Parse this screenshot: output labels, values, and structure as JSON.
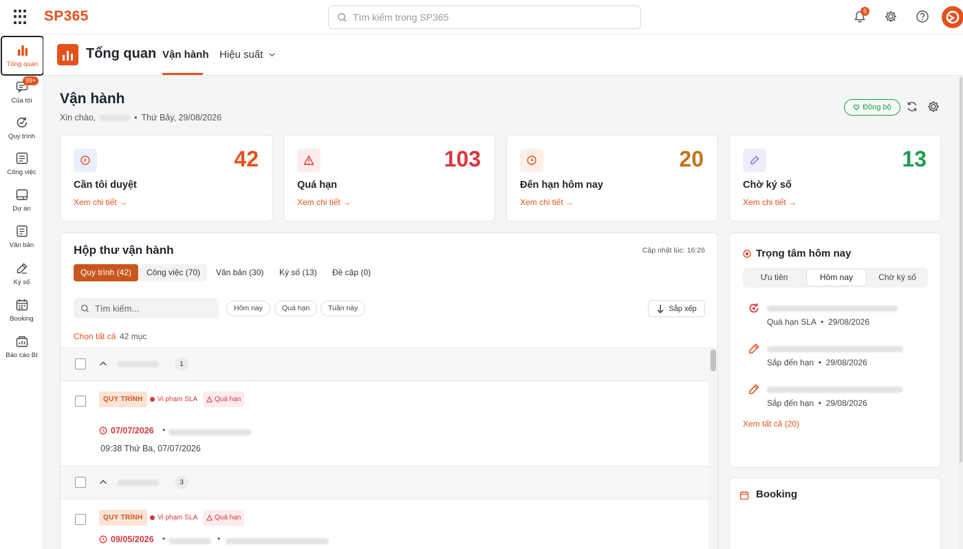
{
  "topbar": {
    "brand": "SP365",
    "search_placeholder": "Tìm kiếm trong SP365",
    "notification_count": "6"
  },
  "sidebar": {
    "items": [
      {
        "label": "Tổng quan",
        "icon": "bar-chart-icon"
      },
      {
        "label": "Của tôi",
        "icon": "chat-icon",
        "badge": "99+"
      },
      {
        "label": "Quy trình",
        "icon": "process-icon"
      },
      {
        "label": "Công việc",
        "icon": "task-list-icon"
      },
      {
        "label": "Dự án",
        "icon": "project-icon"
      },
      {
        "label": "Văn bản",
        "icon": "document-icon"
      },
      {
        "label": "Ký số",
        "icon": "sign-icon"
      },
      {
        "label": "Booking",
        "icon": "calendar-icon"
      },
      {
        "label": "Báo cáo BI",
        "icon": "report-icon"
      }
    ]
  },
  "header": {
    "title": "Tổng quan",
    "tabs": [
      {
        "label": "Vận hành",
        "active": true
      },
      {
        "label": "Hiệu suất",
        "active": false
      }
    ]
  },
  "page": {
    "title": "Vận hành",
    "greeting": "Xin chào,",
    "date": "Thứ Bảy, 29/08/2026",
    "sync_label": "Đồng bộ"
  },
  "stats": [
    {
      "value": "42",
      "label": "Cần tôi duyệt",
      "link": "Xem chi tiết →",
      "color": "#e4521c"
    },
    {
      "value": "103",
      "label": "Quá hạn",
      "link": "Xem chi tiết →",
      "color": "#d9363e"
    },
    {
      "value": "20",
      "label": "Đến hạn hôm nay",
      "link": "Xem chi tiết →",
      "color": "#c0741c"
    },
    {
      "value": "13",
      "label": "Chờ ký số",
      "link": "Xem chi tiết →",
      "color": "#1a9e4b"
    }
  ],
  "inbox": {
    "title": "Hộp thư vận hành",
    "updated": "Cập nhật lúc: 16:26",
    "tabs": [
      {
        "label": "Quy trình (42)",
        "active": true
      },
      {
        "label": "Công việc (70)",
        "active": false
      },
      {
        "label": "Văn bản (30)",
        "active": false
      },
      {
        "label": "Ký số (13)",
        "active": false
      },
      {
        "label": "Đề cập (0)",
        "active": false
      }
    ],
    "search_placeholder": "Tìm kiếm...",
    "chips": [
      "Hôm nay",
      "Quá hạn",
      "Tuần này"
    ],
    "sort_label": "Sắp xếp",
    "select_all": "Chọn tất cả",
    "count": "42 mục",
    "groups": [
      {
        "count": "1",
        "item": {
          "type": "QUY TRÌNH",
          "sla": "Vi phạm SLA",
          "overdue": "Quá hạn",
          "date": "07/07/2026",
          "time": "09:38 Thứ Ba, 07/07/2026"
        }
      },
      {
        "count": "3",
        "item": {
          "type": "QUY TRÌNH",
          "sla": "Vi phạm SLA",
          "overdue": "Quá hạn",
          "date": "09/05/2026"
        }
      }
    ]
  },
  "focus": {
    "title": "Trọng tâm hôm nay",
    "tabs": [
      {
        "label": "Ưu tiên",
        "active": false
      },
      {
        "label": "Hôm nay",
        "active": true
      },
      {
        "label": "Chờ ký số",
        "active": false
      }
    ],
    "tasks": [
      {
        "status": "Quá hạn SLA",
        "date": "29/08/2026",
        "icon": "overdue-icon"
      },
      {
        "status": "Sắp đến hạn",
        "date": "29/08/2026",
        "icon": "pen-icon"
      },
      {
        "status": "Sắp đến hạn",
        "date": "29/08/2026",
        "icon": "pen-icon"
      }
    ],
    "see_all": "Xem tất cả (20)"
  },
  "booking": {
    "title": "Booking"
  }
}
